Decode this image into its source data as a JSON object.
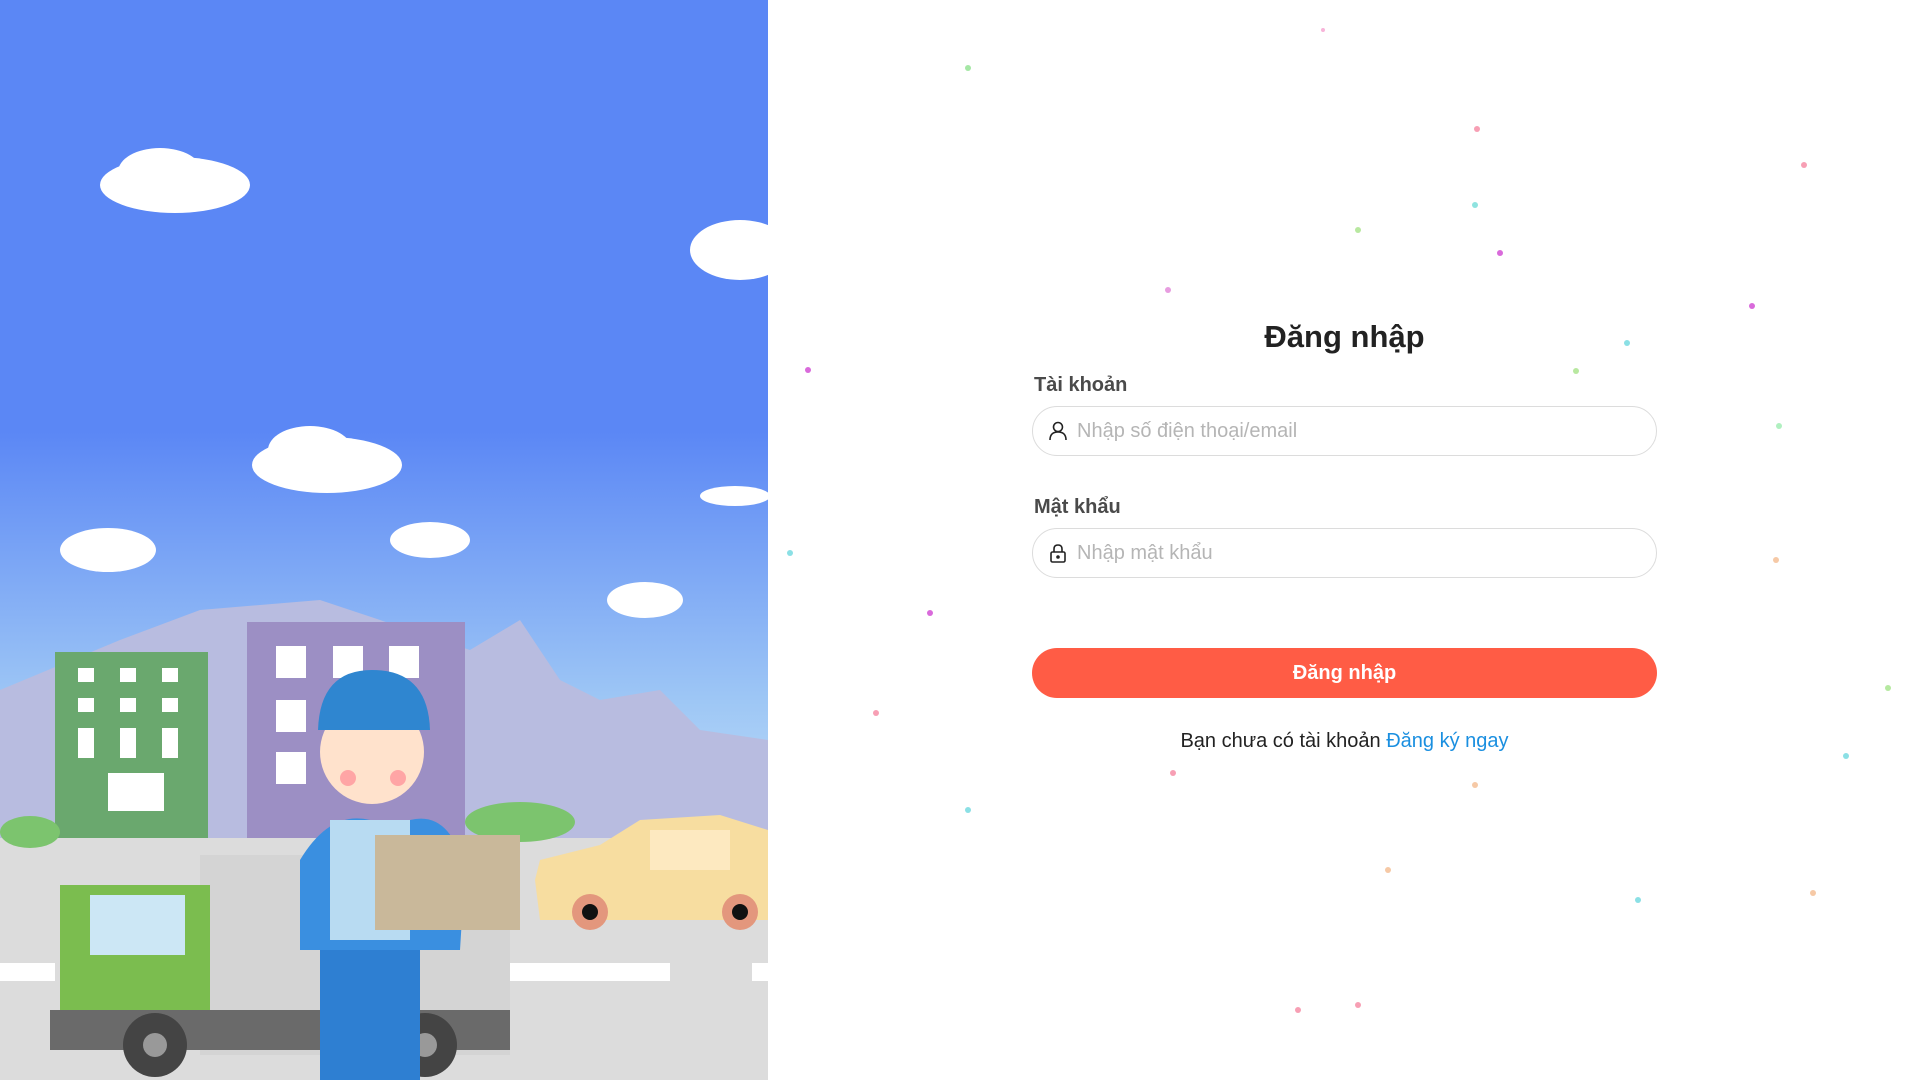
{
  "login": {
    "title": "Đăng nhập",
    "account_label": "Tài khoản",
    "account_placeholder": "Nhập số điện thoại/email",
    "password_label": "Mật khẩu",
    "password_placeholder": "Nhập mật khẩu",
    "submit_label": "Đăng nhập",
    "register_prompt": "Bạn chưa có tài khoản",
    "register_link": "Đăng ký ngay"
  },
  "icons": {
    "account": "user-icon",
    "password": "lock-icon"
  },
  "colors": {
    "primary": "#ff5c45",
    "link": "#1a8fe0",
    "sky": "#5b87f5"
  }
}
